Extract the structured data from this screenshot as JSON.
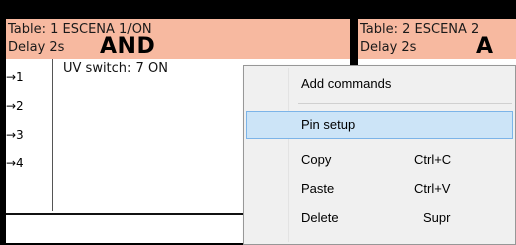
{
  "tables": [
    {
      "title": "Table: 1 ESCENA 1/ON",
      "delay": "Delay 2s",
      "logic": "AND",
      "pins": [
        "→1",
        "→2",
        "→3",
        "→4"
      ],
      "command": "UV switch: 7 ON"
    },
    {
      "title": "Table: 2 ESCENA 2",
      "delay": "Delay 2s",
      "logic": "A"
    }
  ],
  "context_menu": {
    "items": [
      {
        "label": "Add commands",
        "shortcut": ""
      },
      {
        "label": "Pin setup",
        "shortcut": ""
      },
      {
        "label": "Copy",
        "shortcut": "Ctrl+C"
      },
      {
        "label": "Paste",
        "shortcut": "Ctrl+V"
      },
      {
        "label": "Delete",
        "shortcut": "Supr"
      }
    ]
  },
  "colors": {
    "header_bg": "#f7b9a0",
    "highlight": "#cce4f7"
  }
}
